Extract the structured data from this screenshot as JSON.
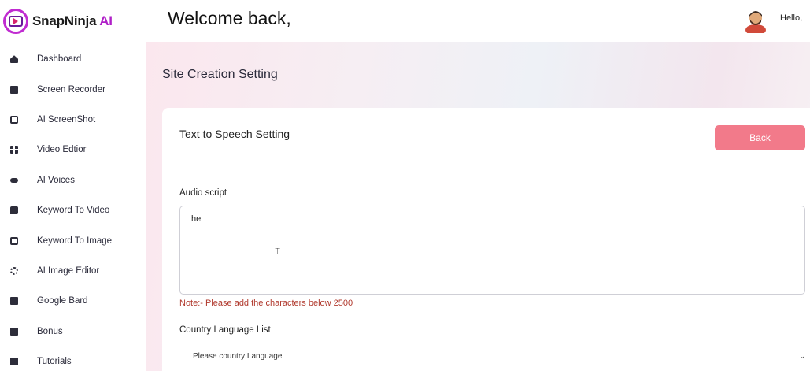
{
  "brand": {
    "name": "SnapNinja",
    "suffix": " AI"
  },
  "header": {
    "welcome": "Welcome back,",
    "greeting": "Hello,"
  },
  "sidebar": {
    "items": [
      {
        "label": "Dashboard",
        "icon": "home-icon"
      },
      {
        "label": "Screen Recorder",
        "icon": "recorder-icon"
      },
      {
        "label": "AI ScreenShot",
        "icon": "screenshot-icon"
      },
      {
        "label": "Video Edtior",
        "icon": "grid-icon"
      },
      {
        "label": "AI Voices",
        "icon": "voice-icon"
      },
      {
        "label": "Keyword To Video",
        "icon": "chat-icon"
      },
      {
        "label": "Keyword To Image",
        "icon": "image-icon"
      },
      {
        "label": "AI Image Editor",
        "icon": "gear-icon"
      },
      {
        "label": "Google Bard",
        "icon": "bard-icon"
      },
      {
        "label": "Bonus",
        "icon": "bonus-icon"
      },
      {
        "label": "Tutorials",
        "icon": "tutorials-icon"
      }
    ]
  },
  "main": {
    "page_title": "Site Creation Setting",
    "card": {
      "title": "Text to Speech Setting",
      "back_label": "Back",
      "audio_label": "Audio script",
      "audio_value": "hel",
      "note": "Note:- Please add the characters below 2500",
      "country_label": "Country Language List",
      "country_selected": "Please country Language"
    }
  },
  "colors": {
    "accent": "#f27a8a",
    "brand": "#b020c8",
    "note": "#b0382c"
  }
}
